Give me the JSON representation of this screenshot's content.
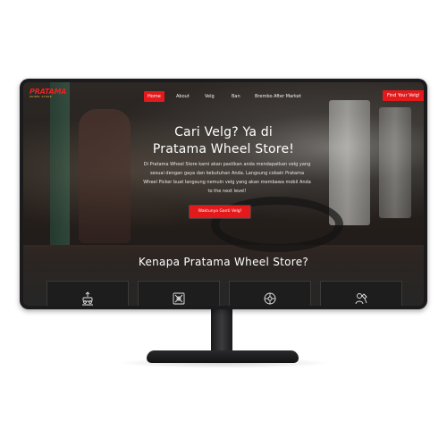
{
  "logo": {
    "name": "PRATAMA",
    "tagline": "WHEEL STORE"
  },
  "nav": {
    "items": [
      {
        "label": "Home",
        "active": true
      },
      {
        "label": "About",
        "active": false
      },
      {
        "label": "Velg",
        "active": false
      },
      {
        "label": "Ban",
        "active": false
      },
      {
        "label": "Brembo After Market",
        "active": false
      }
    ],
    "cta_label": "Find Your Velg!"
  },
  "hero": {
    "title_line1": "Cari Velg? Ya di",
    "title_line2": "Pratama Wheel Store!",
    "description": "Di Pratama Wheel Store kami akan pastikan anda mendapatkan velg yang sesuai dengan gaya dan kebutuhan Anda. Langsung cobain Pratama Wheel Picker buat langsung nemuin velg yang akan membawa mobil Anda to the next level!",
    "button_label": "Waktunya Ganti Velg!"
  },
  "section": {
    "title": "Kenapa Pratama Wheel Store?",
    "features": [
      {
        "icon": "car-lift-icon"
      },
      {
        "icon": "tools-icon"
      },
      {
        "icon": "wheel-icon"
      },
      {
        "icon": "mechanic-icon"
      }
    ]
  },
  "colors": {
    "accent": "#e3191c",
    "dark_bg": "#262626",
    "bezel": "#1b1b1d"
  }
}
